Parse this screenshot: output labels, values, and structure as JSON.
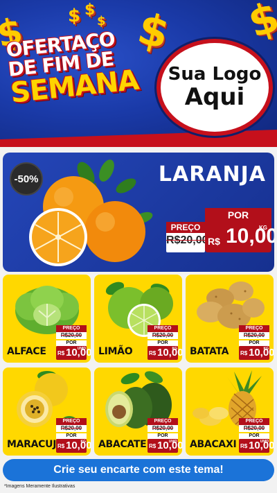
{
  "header": {
    "title_line1": "OFERTAÇO",
    "title_line2": "DE FIM DE",
    "title_line3": "SEMANA",
    "logo_line1": "Sua Logo",
    "logo_line2": "Aqui",
    "currency_symbol": "$"
  },
  "featured": {
    "name": "LARANJA",
    "discount": "-50%",
    "price_label": "PREÇO",
    "old_price": "R$20,00",
    "por_label": "POR",
    "currency": "R$",
    "new_price": "10,00",
    "unit": "KG",
    "icon": "orange-icon"
  },
  "products": [
    {
      "name": "ALFACE",
      "price_label": "PREÇO",
      "old_price": "R$20,00",
      "por_label": "POR",
      "currency": "R$",
      "new_price": "10,00",
      "unit": "UNID",
      "icon": "lettuce-icon"
    },
    {
      "name": "LIMÃO",
      "price_label": "PREÇO",
      "old_price": "R$20,00",
      "por_label": "POR",
      "currency": "R$",
      "new_price": "10,00",
      "unit": "KG",
      "icon": "lime-icon"
    },
    {
      "name": "BATATA",
      "price_label": "PREÇO",
      "old_price": "R$20,00",
      "por_label": "POR",
      "currency": "R$",
      "new_price": "10,00",
      "unit": "KG",
      "icon": "potato-icon"
    },
    {
      "name": "MARACUJÁ",
      "price_label": "PREÇO",
      "old_price": "R$20,00",
      "por_label": "POR",
      "currency": "R$",
      "new_price": "10,00",
      "unit": "KG",
      "icon": "passion-fruit-icon"
    },
    {
      "name": "ABACATE",
      "price_label": "PREÇO",
      "old_price": "R$20,00",
      "por_label": "POR",
      "currency": "R$",
      "new_price": "10,00",
      "unit": "UNID",
      "icon": "avocado-icon"
    },
    {
      "name": "ABACAXI",
      "price_label": "PREÇO",
      "old_price": "R$20,00",
      "por_label": "POR",
      "currency": "R$",
      "new_price": "10,00",
      "unit": "UNID",
      "icon": "pineapple-icon"
    }
  ],
  "footer": {
    "cta_label": "Crie seu encarte com este tema!",
    "disclaimer": "*Imagens Meramente Ilustrativas"
  },
  "colors": {
    "header_blue": "#1a3aa8",
    "accent_red": "#b20f1a",
    "card_yellow": "#ffd800",
    "cta_blue": "#1b73d8"
  }
}
